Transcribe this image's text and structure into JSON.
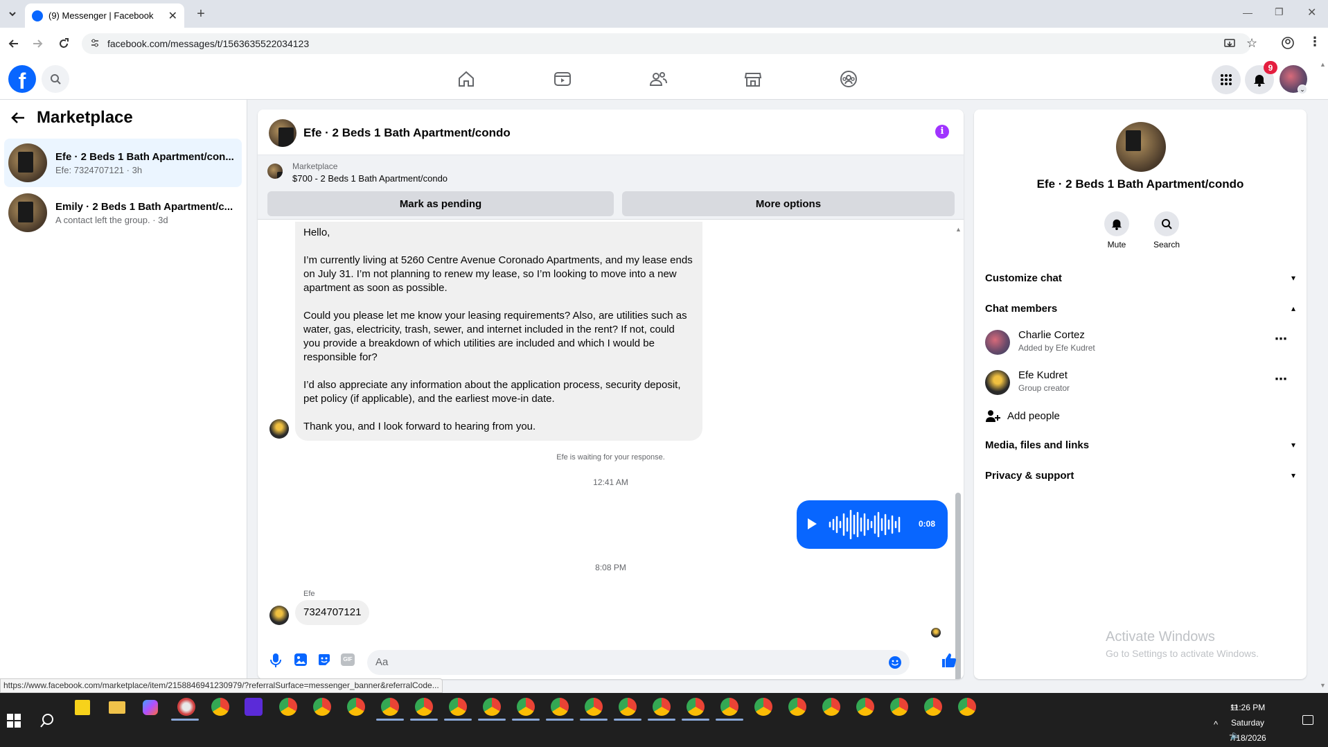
{
  "browser": {
    "tab_title": "(9) Messenger | Facebook",
    "url": "facebook.com/messages/t/1563635522034123",
    "status_url": "https://www.facebook.com/marketplace/item/2158846941230979/?referralSurface=messenger_banner&referralCode..."
  },
  "header": {
    "notification_count": "9"
  },
  "left": {
    "title": "Marketplace",
    "conversations": [
      {
        "name": "Efe · 2 Beds 1 Bath Apartment/con...",
        "preview": "Efe: 7324707121 · 3h",
        "active": true
      },
      {
        "name": "Emily · 2 Beds 1 Bath Apartment/c...",
        "preview": "A contact left the group. · 3d",
        "active": false
      }
    ]
  },
  "chat": {
    "title": "Efe · 2 Beds 1 Bath Apartment/condo",
    "banner_label": "Marketplace",
    "banner_listing": "$700 - 2 Beds 1 Bath Apartment/condo",
    "mark_pending": "Mark as pending",
    "more_options": "More options",
    "message_1": {
      "p1": "Hello,",
      "p2": "I’m currently living at 5260 Centre Avenue Coronado Apartments, and my lease ends on July 31. I’m not planning to renew my lease, so I’m looking to move into a new apartment as soon as possible.",
      "p3": "Could you please let me know your leasing requirements? Also, are utilities such as water, gas, electricity, trash, sewer, and internet included in the rent? If not, could you provide a breakdown of which utilities are included and which I would be responsible for?",
      "p4": "I’d also appreciate any information about the application process, security deposit, pet policy (if applicable), and the earliest move-in date.",
      "p5": "Thank you, and I look forward to hearing from you."
    },
    "waiting_text": "Efe is waiting for your response.",
    "time_1": "12:41 AM",
    "voice_duration": "0:08",
    "time_2": "8:08 PM",
    "sender_name": "Efe",
    "message_2": "7324707121",
    "composer_placeholder": "Aa"
  },
  "right": {
    "title": "Efe · 2 Beds 1 Bath Apartment/condo",
    "mute_label": "Mute",
    "search_label": "Search",
    "customize_chat": "Customize chat",
    "chat_members": "Chat members",
    "members": [
      {
        "name": "Charlie Cortez",
        "sub": "Added by Efe Kudret"
      },
      {
        "name": "Efe Kudret",
        "sub": "Group creator"
      }
    ],
    "add_people": "Add people",
    "media_files": "Media, files and links",
    "privacy_support": "Privacy & support",
    "watermark_title": "Activate Windows",
    "watermark_sub": "Go to Settings to activate Windows."
  },
  "taskbar": {
    "time": "11:26 PM",
    "day": "Saturday",
    "date": "7/18/2026"
  },
  "colors": {
    "brand": "#0866ff",
    "accent_purple": "#a033ff",
    "badge": "#e41e3f"
  }
}
